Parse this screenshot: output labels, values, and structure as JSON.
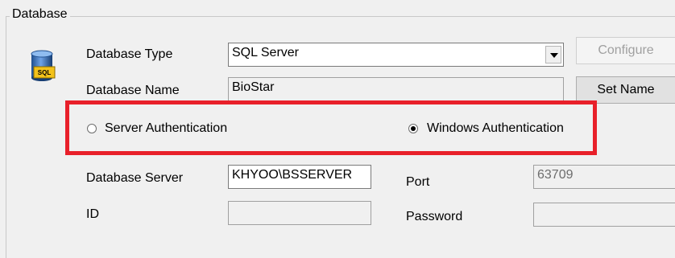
{
  "group": {
    "title": "Database"
  },
  "icon": {
    "name": "database-sql-icon",
    "badge": "SQL"
  },
  "database_type": {
    "label": "Database Type",
    "value": "SQL Server"
  },
  "configure_button": {
    "label": "Configure",
    "enabled": false
  },
  "database_name": {
    "label": "Database Name",
    "value": "BioStar"
  },
  "set_name_button": {
    "label": "Set Name"
  },
  "auth": {
    "server_label": "Server Authentication",
    "windows_label": "Windows Authentication",
    "selected": "windows"
  },
  "database_server": {
    "label": "Database Server",
    "value": "KHYOO\\BSSERVER"
  },
  "port": {
    "label": "Port",
    "value": "63709"
  },
  "id": {
    "label": "ID",
    "value": ""
  },
  "password": {
    "label": "Password",
    "value": ""
  },
  "colors": {
    "highlight": "#e8202a",
    "window_bg": "#f0f0f0"
  }
}
